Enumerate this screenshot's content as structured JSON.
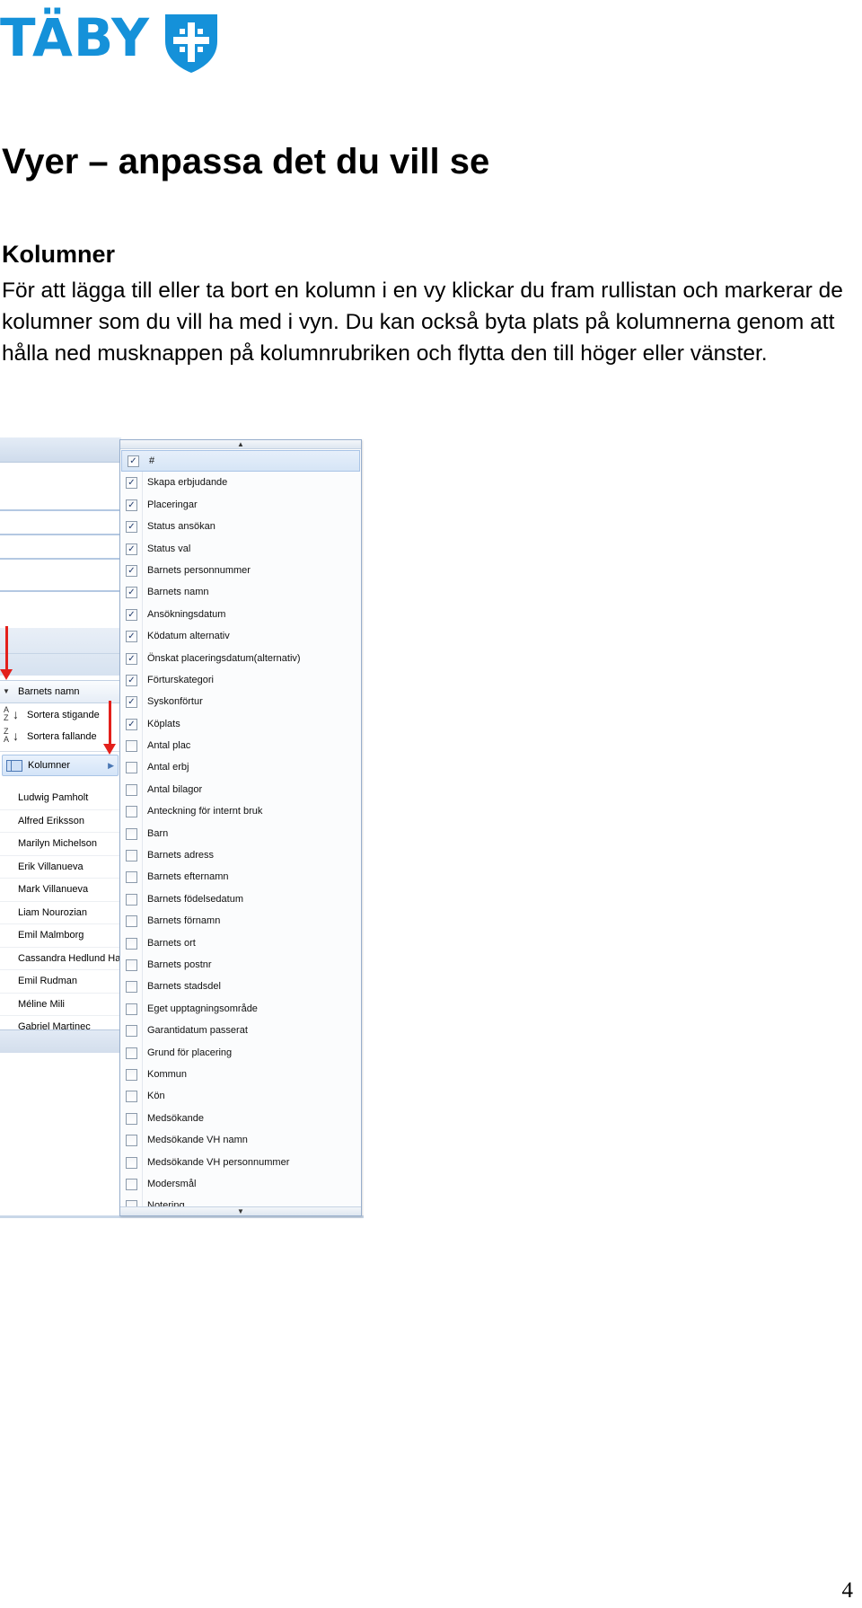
{
  "header": {
    "logo_text": "TÄBY"
  },
  "title": "Vyer – anpassa det du vill se",
  "section_heading": "Kolumner",
  "body_text": "För att lägga till eller ta bort en kolumn i en vy klickar du fram rullistan och markerar de kolumner som du vill ha med i vyn. Du kan också byta plats på kolumnerna genom att hålla ned musknappen på kolumnrubriken och flytta den till höger eller vänster.",
  "page_number": "4",
  "screenshot": {
    "column_header": "Barnets namn",
    "sort_ascending": "Sortera stigande",
    "sort_descending": "Sortera fallande",
    "sort_asc_icon_top": "A",
    "sort_asc_icon_bottom": "Z",
    "sort_desc_icon_top": "Z",
    "sort_desc_icon_bottom": "A",
    "columns_menu": "Kolumner",
    "names": [
      "Ludwig Pamholt",
      "Alfred Eriksson",
      "Marilyn Michelson",
      "Erik Villanueva",
      "Mark Villanueva",
      "Liam Nourozian",
      "Emil Malmborg",
      "Cassandra Hedlund Ha",
      "Emil Rudman",
      "Méline Mili",
      "Gabriel Martinec"
    ],
    "column_options": [
      {
        "label": "#",
        "checked": true
      },
      {
        "label": "Skapa erbjudande",
        "checked": true
      },
      {
        "label": "Placeringar",
        "checked": true
      },
      {
        "label": "Status ansökan",
        "checked": true
      },
      {
        "label": "Status val",
        "checked": true
      },
      {
        "label": "Barnets personnummer",
        "checked": true
      },
      {
        "label": "Barnets namn",
        "checked": true
      },
      {
        "label": "Ansökningsdatum",
        "checked": true
      },
      {
        "label": "Ködatum alternativ",
        "checked": true
      },
      {
        "label": "Önskat placeringsdatum(alternativ)",
        "checked": true
      },
      {
        "label": "Förturskategori",
        "checked": true
      },
      {
        "label": "Syskonförtur",
        "checked": true
      },
      {
        "label": "Köplats",
        "checked": true
      },
      {
        "label": "Antal plac",
        "checked": false
      },
      {
        "label": "Antal erbj",
        "checked": false
      },
      {
        "label": "Antal bilagor",
        "checked": false
      },
      {
        "label": "Anteckning för internt bruk",
        "checked": false
      },
      {
        "label": "Barn",
        "checked": false
      },
      {
        "label": "Barnets adress",
        "checked": false
      },
      {
        "label": "Barnets efternamn",
        "checked": false
      },
      {
        "label": "Barnets födelsedatum",
        "checked": false
      },
      {
        "label": "Barnets förnamn",
        "checked": false
      },
      {
        "label": "Barnets ort",
        "checked": false
      },
      {
        "label": "Barnets postnr",
        "checked": false
      },
      {
        "label": "Barnets stadsdel",
        "checked": false
      },
      {
        "label": "Eget upptagningsområde",
        "checked": false
      },
      {
        "label": "Garantidatum passerat",
        "checked": false
      },
      {
        "label": "Grund för placering",
        "checked": false
      },
      {
        "label": "Kommun",
        "checked": false
      },
      {
        "label": "Kön",
        "checked": false
      },
      {
        "label": "Medsökande",
        "checked": false
      },
      {
        "label": "Medsökande VH namn",
        "checked": false
      },
      {
        "label": "Medsökande VH personnummer",
        "checked": false
      },
      {
        "label": "Modersmål",
        "checked": false
      },
      {
        "label": "Notering",
        "checked": false
      }
    ],
    "check_glyph": "✓",
    "scroll_up_glyph": "▲",
    "scroll_down_glyph": "▼",
    "dropdown_glyph": "▼",
    "submenu_glyph": "▶"
  },
  "colors": {
    "brand_blue": "#1591d9",
    "annotation_red": "#e3201b"
  },
  "icons": {
    "logo": "shield-cross-icon",
    "sort_ascending": "sort-ascending-icon",
    "sort_descending": "sort-descending-icon",
    "columns": "columns-icon",
    "arrow": "red-arrow-annotation"
  }
}
